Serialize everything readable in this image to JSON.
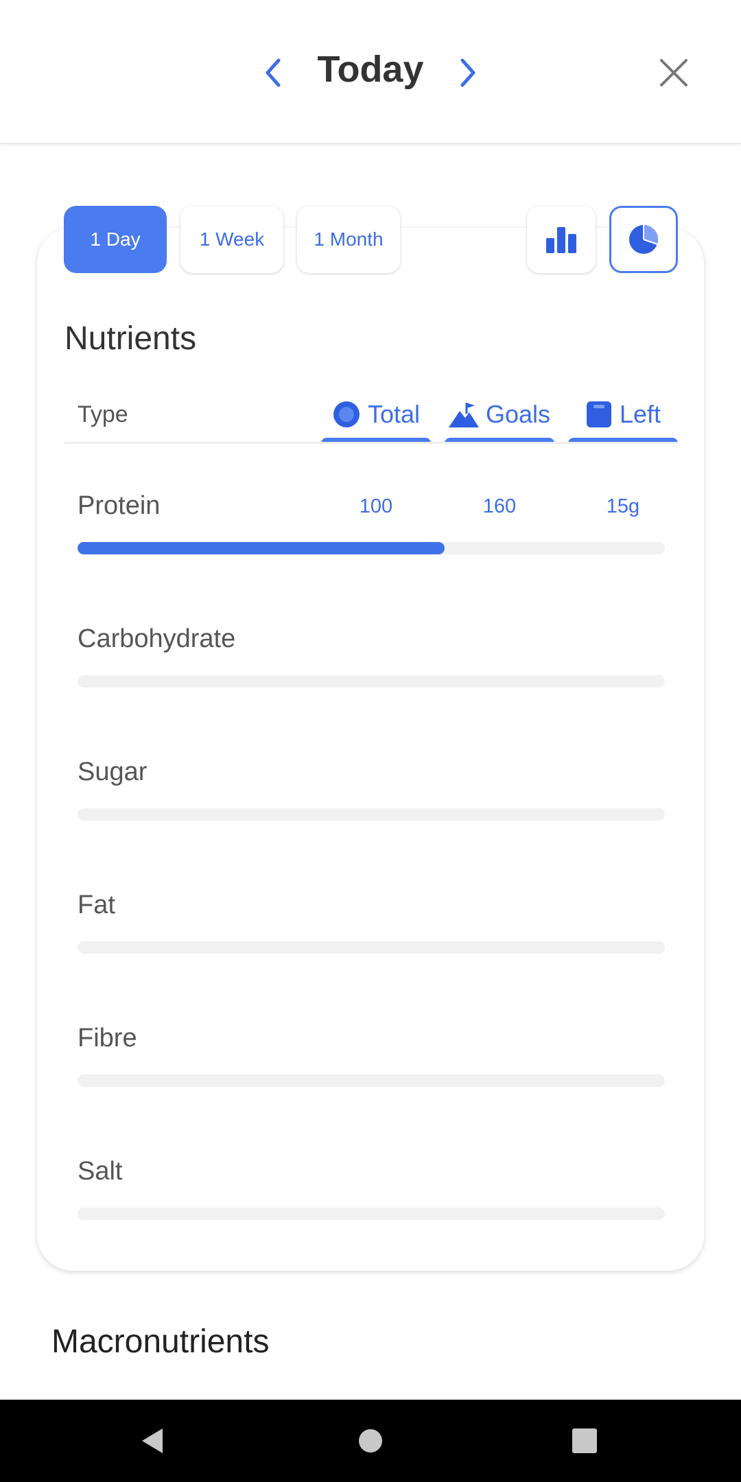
{
  "header": {
    "title": "Today"
  },
  "range_tabs": [
    "1 Day",
    "1 Week",
    "1 Month"
  ],
  "active_range": "1 Day",
  "nutrients": {
    "title": "Nutrients",
    "type_label": "Type",
    "columns": [
      "Total",
      "Goals",
      "Left"
    ],
    "rows": [
      {
        "label": "Protein",
        "total": "100",
        "goal": "160",
        "left": "15g",
        "progress": 0.625
      },
      {
        "label": "Carbohydrate",
        "total": "",
        "goal": "",
        "left": "",
        "progress": 0
      },
      {
        "label": "Sugar",
        "total": "",
        "goal": "",
        "left": "",
        "progress": 0
      },
      {
        "label": "Fat",
        "total": "",
        "goal": "",
        "left": "",
        "progress": 0
      },
      {
        "label": "Fibre",
        "total": "",
        "goal": "",
        "left": "",
        "progress": 0
      },
      {
        "label": "Salt",
        "total": "",
        "goal": "",
        "left": "",
        "progress": 0
      }
    ]
  },
  "macronutrients": {
    "title": "Macronutrients"
  },
  "colors": {
    "accent": "#4a7bef",
    "text": "#555555",
    "track": "#f1f1f1"
  }
}
